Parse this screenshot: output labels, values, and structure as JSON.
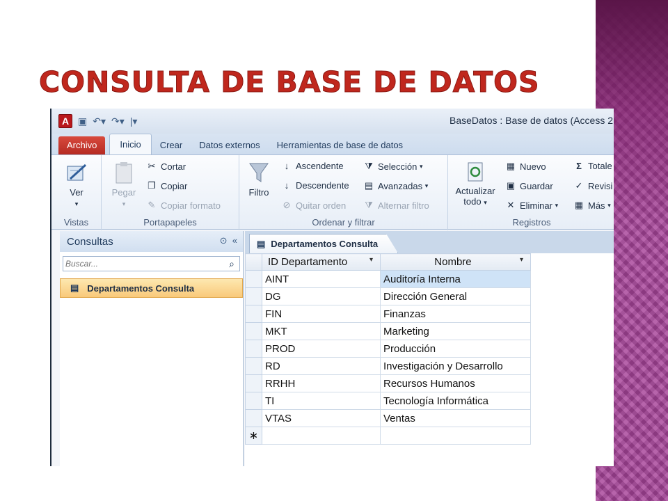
{
  "slide_title": "Consulta de Base de Datos",
  "window": {
    "title": "BaseDatos : Base de datos (Access 2",
    "app_icon": "A"
  },
  "ribbon_tabs": [
    "Archivo",
    "Inicio",
    "Crear",
    "Datos externos",
    "Herramientas de base de datos"
  ],
  "ribbon": {
    "vistas": {
      "label": "Vistas",
      "ver": "Ver"
    },
    "portapapeles": {
      "label": "Portapapeles",
      "pegar": "Pegar",
      "cortar": "Cortar",
      "copiar": "Copiar",
      "copiar_formato": "Copiar formato"
    },
    "ordenar": {
      "label": "Ordenar y filtrar",
      "filtro": "Filtro",
      "ascendente": "Ascendente",
      "descendente": "Descendente",
      "quitar_orden": "Quitar orden",
      "seleccion": "Selección",
      "avanzadas": "Avanzadas",
      "alternar_filtro": "Alternar filtro"
    },
    "registros": {
      "label": "Registros",
      "actualizar": "Actualizar",
      "todo": "todo",
      "nuevo": "Nuevo",
      "guardar": "Guardar",
      "eliminar": "Eliminar",
      "totales": "Totale",
      "revision": "Revisi",
      "mas": "Más"
    }
  },
  "nav_pane": {
    "header": "Consultas",
    "search_placeholder": "Buscar...",
    "items": [
      "Departamentos Consulta"
    ]
  },
  "document": {
    "tab": "Departamentos Consulta",
    "columns": [
      "ID Departamento",
      "Nombre"
    ],
    "rows": [
      [
        "AINT",
        "Auditoría Interna"
      ],
      [
        "DG",
        "Dirección General"
      ],
      [
        "FIN",
        "Finanzas"
      ],
      [
        "MKT",
        "Marketing"
      ],
      [
        "PROD",
        "Producción"
      ],
      [
        "RD",
        "Investigación y Desarrollo"
      ],
      [
        "RRHH",
        "Recursos Humanos"
      ],
      [
        "TI",
        "Tecnología Informática"
      ],
      [
        "VTAS",
        "Ventas"
      ]
    ],
    "new_row_marker": "∗"
  },
  "colors": {
    "title": "#c0271d",
    "file_tab": "#b52a22",
    "stripe": "#a8449a",
    "selected_item": "#f9c97a"
  }
}
